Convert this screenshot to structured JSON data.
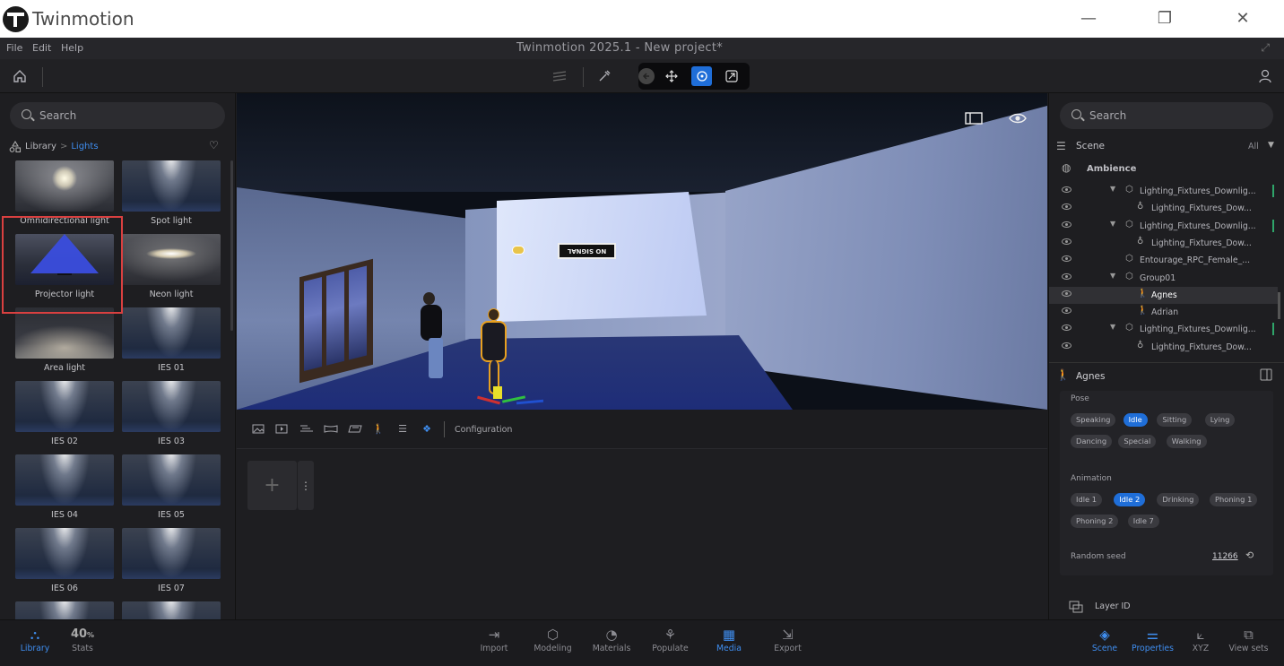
{
  "window": {
    "app_name": "Twinmotion",
    "minimize": "—",
    "restore": "❐",
    "close": "✕"
  },
  "menu": {
    "items": [
      "File",
      "Edit",
      "Help"
    ],
    "title": "Twinmotion 2025.1 - New project*"
  },
  "library": {
    "search_placeholder": "Search",
    "breadcrumb_root": "Library",
    "breadcrumb_sep": ">",
    "breadcrumb_current": "Lights",
    "items": [
      "Omnidirectional light",
      "Spot light",
      "Projector light",
      "Neon light",
      "Area light",
      "IES 01",
      "IES 02",
      "IES 03",
      "IES 04",
      "IES 05",
      "IES 06",
      "IES 07",
      "",
      ""
    ],
    "selected": "Projector light"
  },
  "viewport": {
    "screen_text": "NO SIGNAL"
  },
  "media_toolbar": {
    "config_label": "Configuration"
  },
  "media": {
    "add": "+",
    "more": "⋮"
  },
  "scene": {
    "search_placeholder": "Search",
    "title": "Scene",
    "filter": "All",
    "ambience": "Ambience",
    "nodes": [
      {
        "label": "Lighting_Fixtures_Downlig...",
        "indent": 1,
        "expand": true,
        "mark": true
      },
      {
        "label": "Lighting_Fixtures_Dow...",
        "indent": 2,
        "expand": false,
        "mark": false
      },
      {
        "label": "Lighting_Fixtures_Downlig...",
        "indent": 1,
        "expand": true,
        "mark": true
      },
      {
        "label": "Lighting_Fixtures_Dow...",
        "indent": 2,
        "expand": false,
        "mark": false
      },
      {
        "label": "Entourage_RPC_Female_...",
        "indent": 1,
        "expand": false,
        "mark": false
      },
      {
        "label": "Group01",
        "indent": 1,
        "expand": true,
        "mark": false
      },
      {
        "label": "Agnes",
        "indent": 2,
        "expand": false,
        "mark": false,
        "selected": true
      },
      {
        "label": "Adrian",
        "indent": 2,
        "expand": false,
        "mark": false
      },
      {
        "label": "Lighting_Fixtures_Downlig...",
        "indent": 1,
        "expand": true,
        "mark": true
      },
      {
        "label": "Lighting_Fixtures_Dow...",
        "indent": 2,
        "expand": false,
        "mark": false
      }
    ]
  },
  "properties": {
    "title": "Agnes",
    "pose_label": "Pose",
    "poses": [
      "Speaking",
      "Idle",
      "Sitting",
      "Lying",
      "Dancing",
      "Special",
      "Walking"
    ],
    "pose_selected": "Idle",
    "animation_label": "Animation",
    "animations": [
      "Idle 1",
      "Idle 2",
      "Drinking",
      "Phoning 1",
      "Phoning 2",
      "Idle 7"
    ],
    "animation_selected": "Idle 2",
    "seed_label": "Random seed",
    "seed_value": "11266",
    "layer_label": "Layer ID"
  },
  "bottombar": {
    "left": [
      {
        "label": "Library",
        "active": true
      }
    ],
    "stats_value": "40",
    "stats_unit": "%",
    "stats_label": "Stats",
    "center": [
      {
        "label": "Import",
        "active": false
      },
      {
        "label": "Modeling",
        "active": false
      },
      {
        "label": "Materials",
        "active": false
      },
      {
        "label": "Populate",
        "active": false
      },
      {
        "label": "Media",
        "active": true
      },
      {
        "label": "Export",
        "active": false
      }
    ],
    "right": [
      {
        "label": "Scene",
        "active": true
      },
      {
        "label": "Properties",
        "active": true
      },
      {
        "label": "XYZ",
        "active": false
      },
      {
        "label": "View sets",
        "active": false
      }
    ]
  },
  "colors": {
    "accent": "#3f8ef0",
    "highlight": "#d94040",
    "chip_active": "#1f6ed8"
  }
}
